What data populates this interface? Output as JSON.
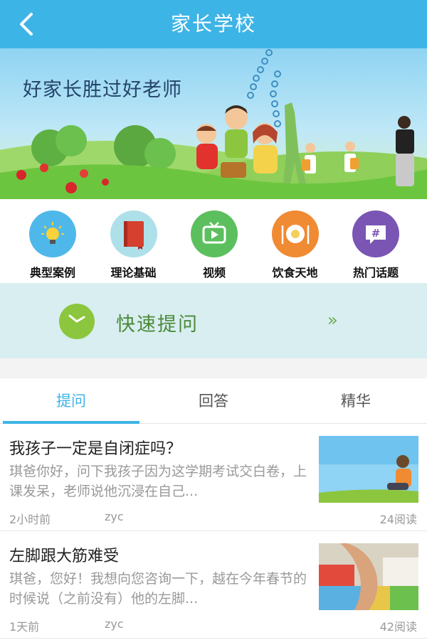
{
  "header": {
    "title": "家长学校"
  },
  "banner": {
    "slogan": "好家长胜过好老师"
  },
  "categories": [
    {
      "label": "典型案例",
      "icon": "lightbulb-icon",
      "color": "#4fb8ea"
    },
    {
      "label": "理论基础",
      "icon": "book-icon",
      "color": "#aee0ea"
    },
    {
      "label": "视频",
      "icon": "tv-icon",
      "color": "#5cbf5e"
    },
    {
      "label": "饮食天地",
      "icon": "plate-icon",
      "color": "#f08a33"
    },
    {
      "label": "热门话题",
      "icon": "hashtag-chat-icon",
      "color": "#7a55b3"
    }
  ],
  "quick_ask": {
    "label": "快速提问",
    "arrow": "»"
  },
  "tabs": [
    {
      "label": "提问",
      "active": true
    },
    {
      "label": "回答",
      "active": false
    },
    {
      "label": "精华",
      "active": false
    }
  ],
  "posts": [
    {
      "title": "我孩子一定是自闭症吗？",
      "excerpt": "琪爸你好，问下我孩子因为这学期考试交白卷，上课发呆，老师说他沉浸在自己...",
      "time": "2小时前",
      "author": "zyc",
      "reads": "24阅读"
    },
    {
      "title": "左脚跟大筋难受",
      "excerpt": "琪爸，您好！我想向您咨询一下，越在今年春节的时候说（之前没有）他的左脚...",
      "time": "1天前",
      "author": "zyc",
      "reads": "42阅读"
    }
  ],
  "colors": {
    "header": "#3db4e6",
    "quick_bg": "#d9eef0",
    "quick_text": "#4b8a3a",
    "active_tab": "#3db4e6"
  }
}
